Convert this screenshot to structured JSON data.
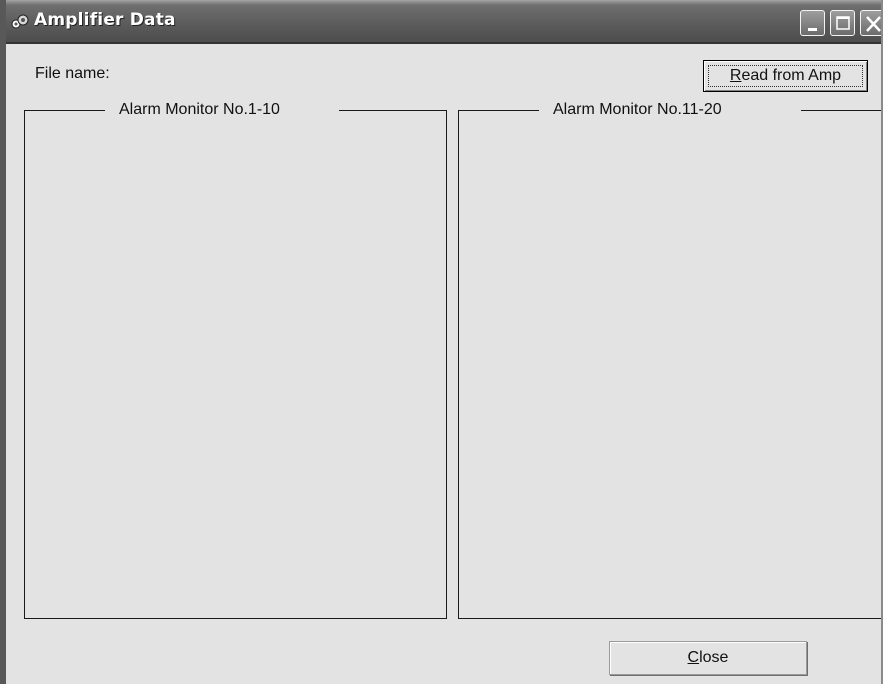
{
  "window": {
    "title": "Amplifier Data",
    "icon": "amplifier-app-icon",
    "controls": [
      "minimize-icon",
      "maximize-icon",
      "close-icon"
    ]
  },
  "file": {
    "label": "File name:",
    "value": ""
  },
  "read_button": {
    "mnemonic": "R",
    "rest": "ead from Amp"
  },
  "groups": {
    "left": {
      "title": "Alarm Monitor No.1-10"
    },
    "right": {
      "title": "Alarm Monitor No.11-20"
    }
  },
  "close_button": {
    "mnemonic": "C",
    "rest": "lose"
  }
}
